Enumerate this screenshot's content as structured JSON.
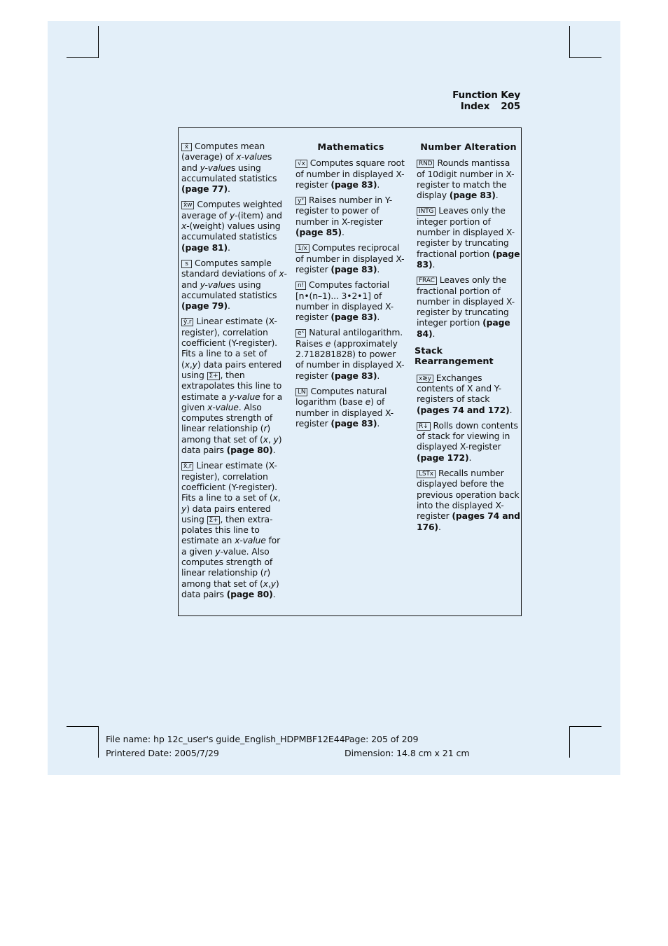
{
  "header": {
    "title": "Function Key Index",
    "page_number": "205"
  },
  "columns": {
    "statistics": [
      {
        "key": "x̄",
        "text": [
          "Computes mean (average) of ",
          {
            "i": "x-value"
          },
          "s and ",
          {
            "i": "y-value"
          },
          "s using accumulated statistics "
        ],
        "page": "(page 77)"
      },
      {
        "key": "x̄w",
        "text": [
          "Computes weighted average of ",
          {
            "i": "y"
          },
          "-(item) and ",
          {
            "i": "x"
          },
          "-(weight) values using accumulated statistics "
        ],
        "page": "(page 81)"
      },
      {
        "key": "s",
        "text": [
          "Computes sample standard deviations of ",
          {
            "i": "x"
          },
          "- and ",
          {
            "i": "y-value"
          },
          "s using accumulated statistics "
        ],
        "page": "(page 79)"
      },
      {
        "key": "ŷ,r",
        "text": [
          "Linear estimate (X-register), correlation coefficient (Y-register). Fits a line to a set of (",
          {
            "i": "x"
          },
          ",",
          {
            "i": "y"
          },
          ") data pairs entered using ",
          {
            "k": "Σ+"
          },
          ", then extrapolates this line to estimate a ",
          {
            "i": "y-value"
          },
          " for a given ",
          {
            "i": "x-value"
          },
          ". Also computes strength of linear relationship (",
          {
            "i": "r"
          },
          ") among that set of (",
          {
            "i": "x"
          },
          ", ",
          {
            "i": "y"
          },
          ") data pairs "
        ],
        "page": "(page 80)"
      },
      {
        "key": "x̂,r",
        "text": [
          "Linear estimate (X-register), correlation coefficient (Y-register). Fits a line to a set of (",
          {
            "i": "x"
          },
          ", ",
          {
            "i": "y"
          },
          ") data pairs entered using ",
          {
            "k": "Σ+"
          },
          ", then extra-polates this line to estimate an ",
          {
            "i": "x-value"
          },
          " for a given ",
          {
            "i": "y"
          },
          "-value. Also computes strength of linear relationship (",
          {
            "i": "r"
          },
          ") among that set of (",
          {
            "i": "x"
          },
          ",",
          {
            "i": "y"
          },
          ") data pairs "
        ],
        "page": "(page 80)"
      }
    ],
    "mathematics": {
      "heading": "Mathematics",
      "entries": [
        {
          "key": "√x",
          "text": [
            "Computes square root of number in displayed X-register "
          ],
          "page": "(page 83)"
        },
        {
          "key": "yˣ",
          "text": [
            "Raises number in Y-register to power of number in X-register "
          ],
          "page": "(page 85)"
        },
        {
          "key": "1/x",
          "text": [
            "Computes reciprocal of number in displayed X-register "
          ],
          "page": "(page 83)"
        },
        {
          "key": "n!",
          "text": [
            "Computes factorial [n•(n–1)... 3•2•1] of number in displayed X-register "
          ],
          "page": "(page 83)"
        },
        {
          "key": "eˣ",
          "text": [
            "Natural antilogarithm. Raises ",
            {
              "i": "e"
            },
            " (approximately 2.718281828) to power of number in displayed X-register "
          ],
          "page": "(page 83)"
        },
        {
          "key": "LN",
          "text": [
            "Computes natural logarithm (base ",
            {
              "i": "e"
            },
            ") of number in displayed X-register "
          ],
          "page": "(page 83)"
        }
      ]
    },
    "number_alteration": {
      "heading": "Number Alteration",
      "entries": [
        {
          "key": "RND",
          "text": [
            "Rounds mantissa of 10digit number in X-register to match the display "
          ],
          "page": "(page 83)"
        },
        {
          "key": "INTG",
          "text": [
            "Leaves only the integer portion of number in displayed X-register by truncating fractional portion "
          ],
          "page": "(page 83)"
        },
        {
          "key": "FRAC",
          "text": [
            "Leaves only the fractional portion of number in displayed X-register by truncating integer portion "
          ],
          "page": "(page 84)"
        }
      ]
    },
    "stack_rearrangement": {
      "heading": "Stack Rearrangement",
      "entries": [
        {
          "key": "x≷y",
          "text": [
            "Exchanges contents of X and Y-registers of stack "
          ],
          "page": "(pages 74 and 172)"
        },
        {
          "key": "R↓",
          "text": [
            "Rolls down contents of stack for viewing in displayed X-register "
          ],
          "page": "(page 172)"
        },
        {
          "key": "LSTx",
          "text": [
            "Recalls number displayed before the previous operation back into the displayed X-register "
          ],
          "page": "(pages 74 and 176)"
        }
      ]
    }
  },
  "footer": {
    "file_name": "File name: hp 12c_user's guide_English_HDPMBF12E44",
    "printed_date": "Printered Date: 2005/7/29",
    "page": "Page: 205 of 209",
    "dimension": "Dimension: 14.8 cm x 21 cm"
  }
}
